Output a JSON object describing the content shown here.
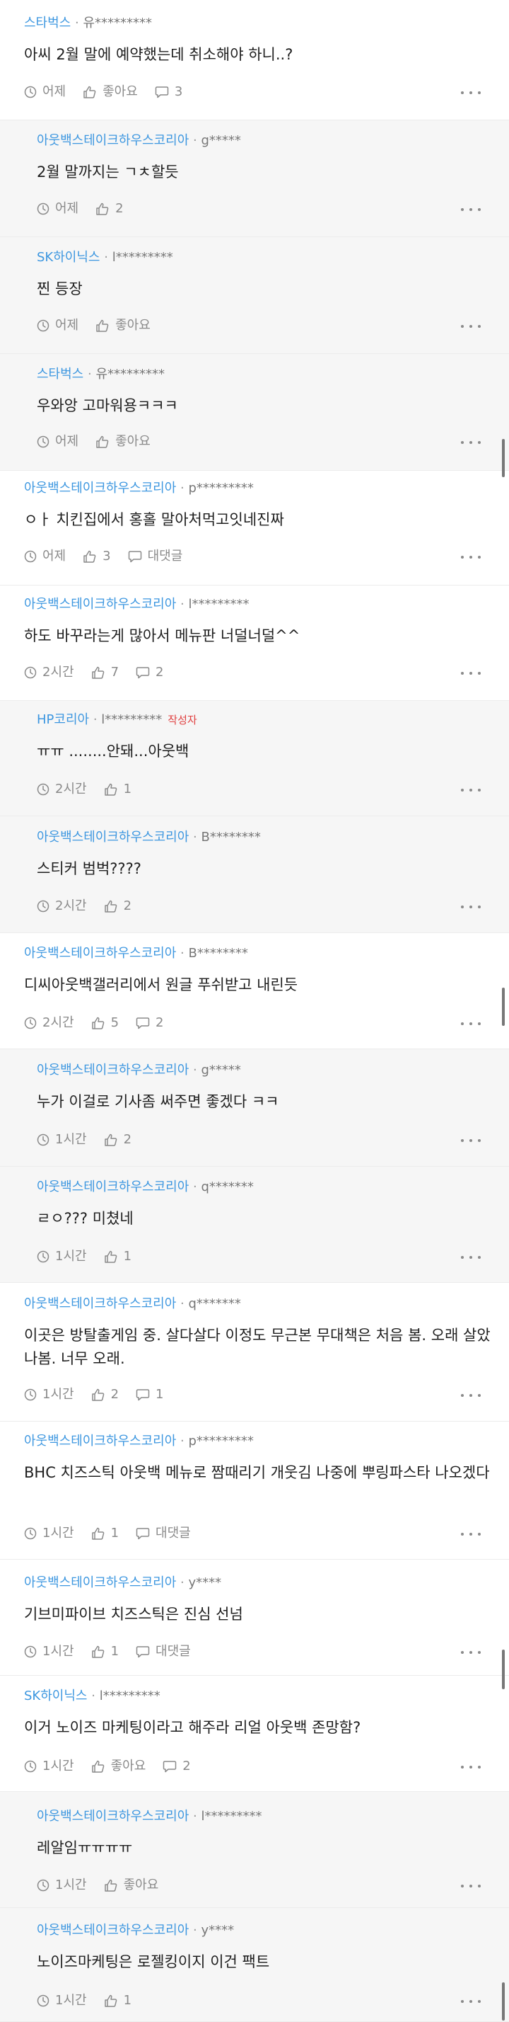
{
  "comments": [
    {
      "team": "스타벅스",
      "sep": "·",
      "uid": "유*********",
      "author_tag": "",
      "text": "아씨 2월 말에 예약했는데 취소해야 하니..?",
      "time": "어제",
      "likes": "좋아요",
      "replies": "3",
      "reply": false
    },
    {
      "team": "아웃백스테이크하우스코리아",
      "sep": "·",
      "uid": "g*****",
      "author_tag": "",
      "text": "2월 말까지는 ㄱㅊ할듯",
      "time": "어제",
      "likes": "2",
      "replies": "",
      "reply": true
    },
    {
      "team": "SK하이닉스",
      "sep": "·",
      "uid": "l*********",
      "author_tag": "",
      "text": "찐 등장",
      "time": "어제",
      "likes": "좋아요",
      "replies": "",
      "reply": true
    },
    {
      "team": "스타벅스",
      "sep": "·",
      "uid": "유*********",
      "author_tag": "",
      "text": "우와앙 고마워용ㅋㅋㅋ",
      "time": "어제",
      "likes": "좋아요",
      "replies": "",
      "reply": true
    },
    {
      "team": "아웃백스테이크하우스코리아",
      "sep": "·",
      "uid": "p*********",
      "author_tag": "",
      "text": "ㅇㅏ 치킨집에서 홍홀 말아처먹고잇네진짜",
      "time": "어제",
      "likes": "3",
      "replies": "대댓글",
      "reply": false
    },
    {
      "team": "아웃백스테이크하우스코리아",
      "sep": "·",
      "uid": "l*********",
      "author_tag": "",
      "text": "하도 바꾸라는게 많아서 메뉴판 너덜너덜^^",
      "time": "2시간",
      "likes": "7",
      "replies": "2",
      "reply": false
    },
    {
      "team": "HP코리아",
      "sep": "·",
      "uid": "l*********",
      "author_tag": "작성자",
      "text": "ㅠㅠ ........안돼...아웃백",
      "time": "2시간",
      "likes": "1",
      "replies": "",
      "reply": true
    },
    {
      "team": "아웃백스테이크하우스코리아",
      "sep": "·",
      "uid": "B********",
      "author_tag": "",
      "text": "스티커 범벅????",
      "time": "2시간",
      "likes": "2",
      "replies": "",
      "reply": true
    },
    {
      "team": "아웃백스테이크하우스코리아",
      "sep": "·",
      "uid": "B********",
      "author_tag": "",
      "text": "디씨아웃백갤러리에서 원글 푸쉬받고 내린듯",
      "time": "2시간",
      "likes": "5",
      "replies": "2",
      "reply": false
    },
    {
      "team": "아웃백스테이크하우스코리아",
      "sep": "·",
      "uid": "g*****",
      "author_tag": "",
      "text": "누가 이걸로 기사좀 써주면 좋겠다 ㅋㅋ",
      "time": "1시간",
      "likes": "2",
      "replies": "",
      "reply": true
    },
    {
      "team": "아웃백스테이크하우스코리아",
      "sep": "·",
      "uid": "q*******",
      "author_tag": "",
      "text": "ㄹㅇ??? 미쳤네",
      "time": "1시간",
      "likes": "1",
      "replies": "",
      "reply": true
    },
    {
      "team": "아웃백스테이크하우스코리아",
      "sep": "·",
      "uid": "q*******",
      "author_tag": "",
      "text": "이곳은 방탈출게임 중. 살다살다 이정도 무근본 무대책은 처음 봄. 오래 살았나봄. 너무 오래.",
      "time": "1시간",
      "likes": "2",
      "replies": "1",
      "reply": false
    },
    {
      "team": "아웃백스테이크하우스코리아",
      "sep": "·",
      "uid": "p*********",
      "author_tag": "",
      "text": "BHC 치즈스틱 아웃백 메뉴로 짬때리기 개웃김 나중에 뿌링파스타 나오겠다",
      "time": "1시간",
      "likes": "1",
      "replies": "대댓글",
      "reply": false
    },
    {
      "team": "아웃백스테이크하우스코리아",
      "sep": "·",
      "uid": "y****",
      "author_tag": "",
      "text": "기브미파이브 치즈스틱은 진심 선넘",
      "time": "1시간",
      "likes": "1",
      "replies": "대댓글",
      "reply": false
    },
    {
      "team": "SK하이닉스",
      "sep": "·",
      "uid": "l*********",
      "author_tag": "",
      "text": "이거 노이즈 마케팅이라고 해주라 리얼 아웃백 존망함?",
      "time": "1시간",
      "likes": "좋아요",
      "replies": "2",
      "reply": false
    },
    {
      "team": "아웃백스테이크하우스코리아",
      "sep": "·",
      "uid": "l*********",
      "author_tag": "",
      "text": "레알임ㅠㅠㅠㅠ",
      "time": "1시간",
      "likes": "좋아요",
      "replies": "",
      "reply": true
    },
    {
      "team": "아웃백스테이크하우스코리아",
      "sep": "·",
      "uid": "y****",
      "author_tag": "",
      "text": "노이즈마케팅은 로젤킹이지 이건 팩트",
      "time": "1시간",
      "likes": "1",
      "replies": "",
      "reply": true
    }
  ],
  "icons": {
    "time": "clock-icon",
    "like": "thumbs-up-icon",
    "reply": "speech-bubble-icon",
    "more": "more-dots-icon"
  },
  "colors": {
    "team_link": "#3d97e0",
    "author_tag": "#e04040",
    "reply_bg": "#f6f6f6",
    "meta": "#8a8a8a"
  }
}
